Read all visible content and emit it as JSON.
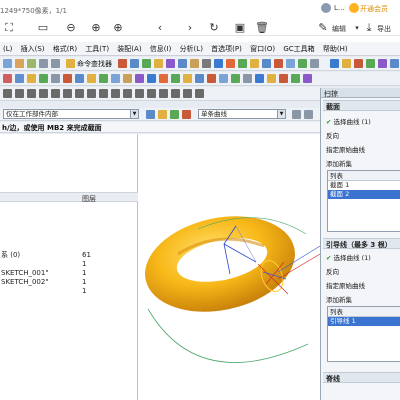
{
  "viewer": {
    "title": "1249*750像素，1/1",
    "user_name": "L...",
    "vip_label": "开通会员",
    "edit_label": "编辑",
    "export_label": "导出"
  },
  "nx": {
    "menus": [
      "(L)",
      "插入(S)",
      "格式(R)",
      "工具(T)",
      "装配(A)",
      "信息(I)",
      "分析(L)",
      "首选项(P)",
      "窗口(O)",
      "GC工具箱",
      "帮助(H)"
    ],
    "toolbar_label": "命令查找器",
    "filter_combo": "仅在工作部件内部",
    "curve_rule_combo": "单条曲线",
    "status_text": "h/边，或使用 MB2 来完成截面",
    "navigator": {
      "col_name": "",
      "col_layer": "图层",
      "rows": [
        {
          "name": "系 (0)",
          "layer": "61"
        },
        {
          "name": "",
          "layer": "1"
        },
        {
          "name": "SKETCH_001\"",
          "layer": "1"
        },
        {
          "name": "SKETCH_002\"",
          "layer": "1"
        },
        {
          "name": "",
          "layer": "1"
        }
      ]
    },
    "panel": {
      "title": "扫掠",
      "section1": "截面",
      "select_curve": "选择曲线 (1)",
      "reverse": "反向",
      "specify_origin": "指定原始曲线",
      "add_new": "添加新集",
      "list_label": "列表",
      "list1_items": [
        "截面 1",
        "截面 2"
      ],
      "section2": "引导线（最多 3 根）",
      "select_curve2": "选择曲线 (1)",
      "reverse2": "反向",
      "specify_origin2": "指定原始曲线",
      "add_new2": "添加新集",
      "list_label2": "列表",
      "list2_items": [
        "引导线 1"
      ],
      "section3": "脊线"
    }
  }
}
